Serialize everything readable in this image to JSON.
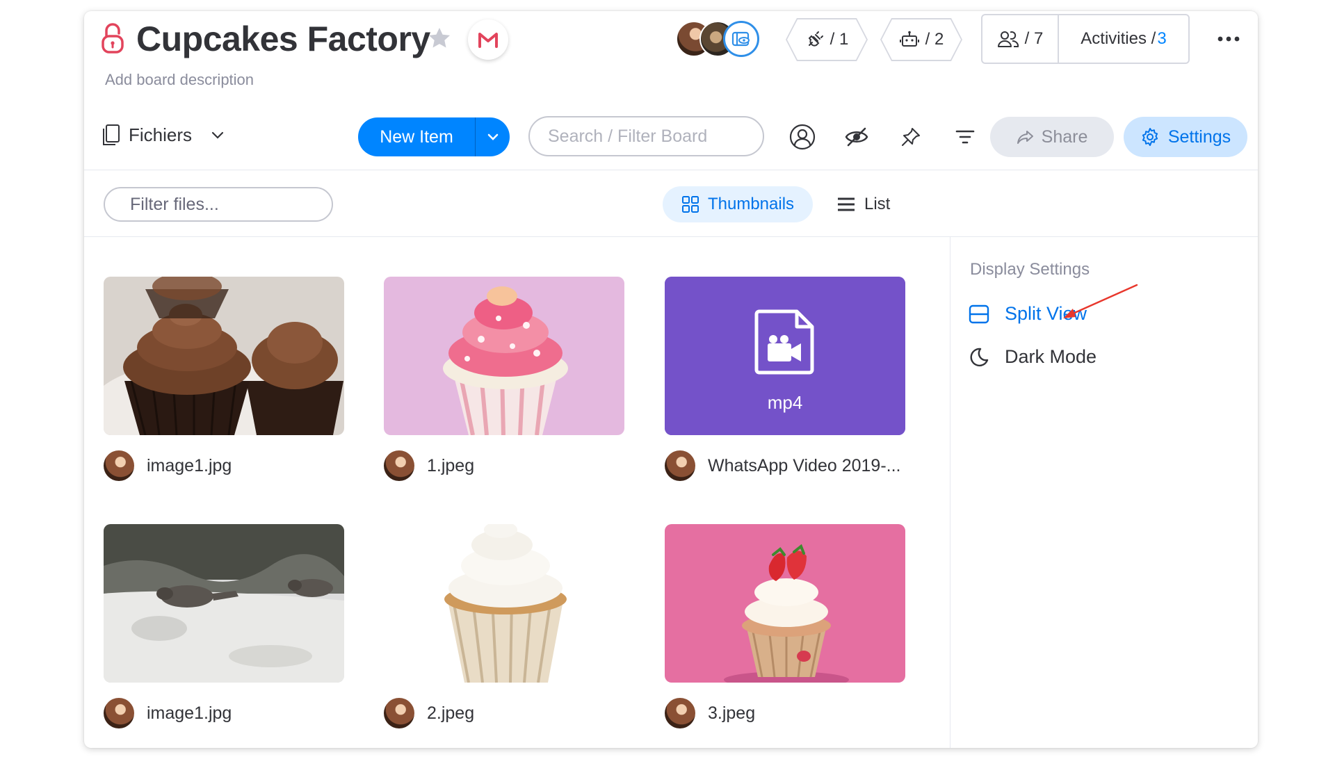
{
  "board": {
    "title": "Cupcakes Factory",
    "description": "Add board description"
  },
  "header": {
    "integrations_count": "/ 1",
    "automations_count": "/ 2",
    "members_count": "/ 7",
    "activities_label": "Activities /",
    "activities_count": "3"
  },
  "toolbar": {
    "view_name": "Fichiers",
    "new_item_label": "New Item",
    "search_placeholder": "Search / Filter Board",
    "share_label": "Share",
    "settings_label": "Settings"
  },
  "files_bar": {
    "filter_placeholder": "Filter files...",
    "thumbnails_label": "Thumbnails",
    "list_label": "List",
    "active_view": "Thumbnails"
  },
  "files": [
    {
      "name": "image1.jpg",
      "kind": "image",
      "subject": "chocolate-cupcakes"
    },
    {
      "name": "1.jpeg",
      "kind": "image",
      "subject": "pink-cupcake"
    },
    {
      "name": "WhatsApp Video 2019-...",
      "kind": "video",
      "type_label": "mp4"
    },
    {
      "name": "image1.jpg",
      "kind": "image",
      "subject": "raccoons-on-sand"
    },
    {
      "name": "2.jpeg",
      "kind": "image",
      "subject": "vanilla-cupcake"
    },
    {
      "name": "3.jpeg",
      "kind": "image",
      "subject": "strawberry-cupcake"
    }
  ],
  "display_settings": {
    "title": "Display Settings",
    "split_view_label": "Split View",
    "dark_mode_label": "Dark Mode"
  },
  "colors": {
    "primary": "#0085ff",
    "settings_bg": "#cce5ff",
    "video_tile": "#7452c9",
    "annotation_arrow": "#e8372c",
    "lock": "#e2445c"
  }
}
